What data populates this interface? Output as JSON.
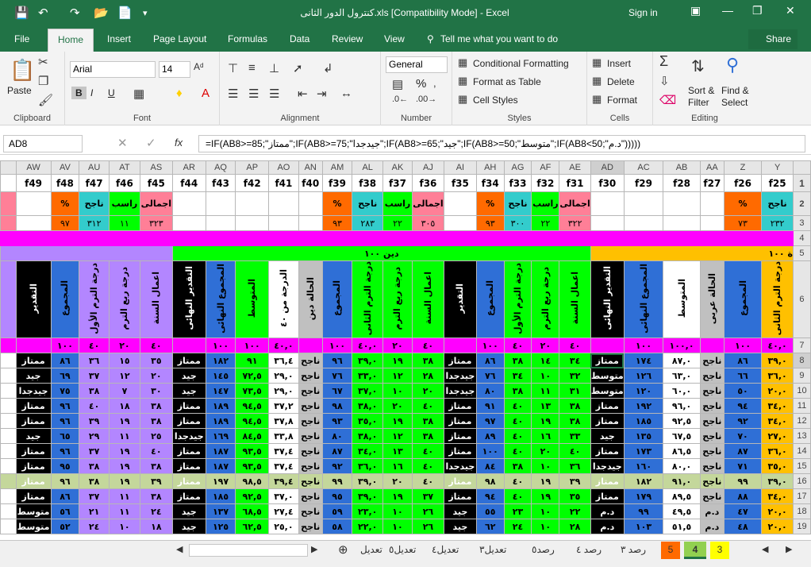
{
  "titlebar": {
    "title": "كنترول الدور الثانى.xls  [Compatibility Mode] - Excel",
    "signin": "Sign in"
  },
  "tabs": [
    "File",
    "Home",
    "Insert",
    "Page Layout",
    "Formulas",
    "Data",
    "Review",
    "View"
  ],
  "tell_me": "Tell me what you want to do",
  "share": "Share",
  "ribbon": {
    "clipboard": {
      "label": "Clipboard",
      "paste": "Paste"
    },
    "font": {
      "label": "Font",
      "name": "Arial",
      "size": "14",
      "bold": "B",
      "italic": "I",
      "underline": "U"
    },
    "alignment": {
      "label": "Alignment"
    },
    "number": {
      "label": "Number",
      "format": "General",
      "pct": "%"
    },
    "styles": {
      "label": "Styles",
      "cond": "Conditional Formatting",
      "table": "Format as Table",
      "cell": "Cell Styles"
    },
    "cells": {
      "label": "Cells",
      "insert": "Insert",
      "delete": "Delete",
      "format": "Format"
    },
    "editing": {
      "label": "Editing",
      "sort": "Sort &",
      "filter": "Filter",
      "find": "Find &",
      "select": "Select"
    }
  },
  "namebox": "AD8",
  "formula": "=IF(AB8>=85;\"ممتاز\";IF(AB8>=75;\"جيدجدا\";IF(AB8>=65;\"جيد\";IF(AB8>=50;\"متوسط\";IF(AB8<50;\"د.م\")))))",
  "colors": {
    "accent": "#217346",
    "magenta": "#ff00ff",
    "green": "#00ff00",
    "blue": "#2f6fd6",
    "purple": "#b386ff",
    "orange": "#ff6a00",
    "yellow": "#ffc000",
    "pink": "#ff7f97",
    "cyan": "#33cccc",
    "gray": "#c0c0c0",
    "olive": "#c4d79b"
  },
  "sheet": {
    "col_letters": [
      "",
      "AW",
      "AV",
      "AU",
      "AT",
      "AS",
      "AR",
      "AQ",
      "AP",
      "AO",
      "AN",
      "AM",
      "AL",
      "AK",
      "AJ",
      "AI",
      "AH",
      "AG",
      "AF",
      "AE",
      "AD",
      "AC",
      "AB",
      "AA",
      "Z",
      "Y",
      ""
    ],
    "row_numbers": [
      "1",
      "2",
      "3",
      "4",
      "5",
      "6",
      "7",
      "8",
      "9",
      "10",
      "11",
      "12",
      "13",
      "14",
      "15",
      "16",
      "17",
      "18",
      "19"
    ],
    "fields": [
      "",
      "f49",
      "f48",
      "f47",
      "f46",
      "f45",
      "f44",
      "f43",
      "f42",
      "f41",
      "f40",
      "f39",
      "f38",
      "f37",
      "f36",
      "f35",
      "f34",
      "f33",
      "f32",
      "f31",
      "f30",
      "f29",
      "f28",
      "f27",
      "f26",
      "f25"
    ],
    "row2": {
      "pct": "%",
      "pass": "ناجح",
      "fail": "راسب",
      "total": "اجمالى"
    },
    "row3": {
      "av": "٩٧",
      "au": "٣١٢",
      "at": "١١",
      "as": "٣٢٣",
      "am": "٩٣",
      "al": "٢٨٣",
      "ak": "٢٢",
      "aj": "٣٠٥",
      "ah": "٩٣",
      "ag": "٣٠٠",
      "af": "٢٢",
      "ae": "٣٢٢",
      "z": "٧٣",
      "y": "٢٣٢"
    },
    "row5": {
      "religion": "دين ١٠٠",
      "arabic": "ة ١٠٠"
    },
    "headers": {
      "grade": "التقدير",
      "total": "المجموع",
      "sec_term": "درجة الترم الثانى",
      "first_term": "درجة الترم الأول",
      "quarter": "درجة ربع الترم",
      "year_work": "اعمال السنة",
      "final_grade": "التقدير النهائى",
      "final_total": "المجموع النهائى",
      "avg": "المتوسط",
      "from40": "الدرجة من ٤٠",
      "religion_status": "الحالة دين",
      "arabic_status": "الحالة عربى"
    },
    "row7": {
      "av": "١٠٠",
      "au": "٤٠",
      "at": "٢٠",
      "as": "٤٠",
      "aq": "١٠٠",
      "ap": "١٠٠",
      "ao": "٤٠,٠",
      "am": "١٠٠",
      "al": "٤٠,٠",
      "ak": "٢٠",
      "aj": "٤٠",
      "ah": "١٠٠",
      "ag": "٤٠",
      "af": "٢٠",
      "ae": "٤٠",
      "ac": "١٠٠",
      "ab": "١٠٠,٠",
      "z": "١٠٠",
      "y": "٤٠,٠"
    },
    "rows": [
      {
        "n": "8",
        "aw": "ممتاز",
        "av": "٨٦",
        "au": "٣٦",
        "at": "١٥",
        "as": "٣٥",
        "ar": "ممتاز",
        "aq": "١٨٢",
        "ap": "٩١",
        "ao": "٣٦,٤",
        "an": "ناجح",
        "am": "٩٦",
        "al": "٣٩,٠",
        "ak": "١٩",
        "aj": "٣٨",
        "ai": "ممتاز",
        "ah": "٨٦",
        "ag": "٣٨",
        "af": "١٤",
        "ae": "٣٤",
        "ad": "ممتاز",
        "ac": "١٧٤",
        "ab": "٨٧,٠",
        "aa": "ناجح",
        "z": "٨٦",
        "y": "٣٩,٠"
      },
      {
        "n": "9",
        "aw": "جيد",
        "av": "٦٩",
        "au": "٣٧",
        "at": "١٢",
        "as": "٢٠",
        "ar": "جيد",
        "aq": "١٤٥",
        "ap": "٧٢,٥",
        "ao": "٢٩,٠",
        "an": "ناجح",
        "am": "٧٦",
        "al": "٣٣,٠",
        "ak": "١٢",
        "aj": "٢٨",
        "ai": "جيدجدا",
        "ah": "٧٦",
        "ag": "٣٤",
        "af": "١٠",
        "ae": "٣٢",
        "ad": "متوسط",
        "ac": "١٢٦",
        "ab": "٦٣,٠",
        "aa": "ناجح",
        "z": "٦٦",
        "y": "٣٦,٠"
      },
      {
        "n": "10",
        "aw": "جيدجدا",
        "av": "٧٥",
        "au": "٣٨",
        "at": "٧",
        "as": "٣٠",
        "ar": "جيد",
        "aq": "١٤٧",
        "ap": "٧٣,٥",
        "ao": "٢٩,٠",
        "an": "ناجح",
        "am": "٦٧",
        "al": "٣٧,٠",
        "ak": "١٠",
        "aj": "٢٠",
        "ai": "جيدجدا",
        "ah": "٨٠",
        "ag": "٣٨",
        "af": "١١",
        "ae": "٣١",
        "ad": "متوسط",
        "ac": "١٢٠",
        "ab": "٦٠,٠",
        "aa": "ناجح",
        "z": "٥٠",
        "y": "٢٠,٠"
      },
      {
        "n": "11",
        "aw": "ممتاز",
        "av": "٩٦",
        "au": "٤٠",
        "at": "١٨",
        "as": "٣٨",
        "ar": "ممتاز",
        "aq": "١٨٩",
        "ap": "٩٤,٥",
        "ao": "٣٧,٢",
        "an": "ناجح",
        "am": "٩٨",
        "al": "٣٨,٠",
        "ak": "٢٠",
        "aj": "٤٠",
        "ai": "ممتاز",
        "ah": "٩١",
        "ag": "٤٠",
        "af": "١٣",
        "ae": "٣٨",
        "ad": "ممتاز",
        "ac": "١٩٢",
        "ab": "٩٦,٠",
        "aa": "ناجح",
        "z": "٩٤",
        "y": "٣٤,٠"
      },
      {
        "n": "12",
        "aw": "ممتاز",
        "av": "٩٦",
        "au": "٣٩",
        "at": "١٩",
        "as": "٣٨",
        "ar": "ممتاز",
        "aq": "١٨٩",
        "ap": "٩٤,٥",
        "ao": "٣٧,٨",
        "an": "ناجح",
        "am": "٩٣",
        "al": "٣٥,٠",
        "ak": "١٩",
        "aj": "٣٨",
        "ai": "ممتاز",
        "ah": "٩٧",
        "ag": "٤٠",
        "af": "١٩",
        "ae": "٣٨",
        "ad": "ممتاز",
        "ac": "١٨٥",
        "ab": "٩٢,٥",
        "aa": "ناجح",
        "z": "٩٢",
        "y": "٣٤,٠"
      },
      {
        "n": "13",
        "aw": "جيد",
        "av": "٦٥",
        "au": "٢٩",
        "at": "١١",
        "as": "٢٥",
        "ar": "جيدجدا",
        "aq": "١٦٩",
        "ap": "٨٤,٥",
        "ao": "٣٣,٨",
        "an": "ناجح",
        "am": "٨٠",
        "al": "٣٨,٠",
        "ak": "١٢",
        "aj": "٣٨",
        "ai": "ممتاز",
        "ah": "٨٩",
        "ag": "٤٠",
        "af": "١٦",
        "ae": "٣٣",
        "ad": "جيد",
        "ac": "١٣٥",
        "ab": "٦٧,٥",
        "aa": "ناجح",
        "z": "٧٠",
        "y": "٢٧,٠"
      },
      {
        "n": "14",
        "aw": "ممتاز",
        "av": "٩٦",
        "au": "٣٧",
        "at": "١٩",
        "as": "٤٠",
        "ar": "ممتاز",
        "aq": "١٨٧",
        "ap": "٩٣,٥",
        "ao": "٣٧,٤",
        "an": "ناجح",
        "am": "٨٧",
        "al": "٣٤,٠",
        "ak": "١٣",
        "aj": "٤٠",
        "ai": "ممتاز",
        "ah": "١٠٠",
        "ag": "٤٠",
        "af": "٢٠",
        "ae": "٤٠",
        "ad": "ممتاز",
        "ac": "١٧٣",
        "ab": "٨٦,٥",
        "aa": "ناجح",
        "z": "٨٧",
        "y": "٣٦,٠"
      },
      {
        "n": "15",
        "aw": "ممتاز",
        "av": "٩٥",
        "au": "٣٨",
        "at": "١٩",
        "as": "٣٨",
        "ar": "ممتاز",
        "aq": "١٨٧",
        "ap": "٩٣,٥",
        "ao": "٣٧,٤",
        "an": "ناجح",
        "am": "٩٢",
        "al": "٣٦,٠",
        "ak": "١٦",
        "aj": "٤٠",
        "ai": "جيدجدا",
        "ah": "٨٤",
        "ag": "٣٨",
        "af": "١٠",
        "ae": "٣٦",
        "ad": "جيدجدا",
        "ac": "١٦٠",
        "ab": "٨٠,٠",
        "aa": "ناجح",
        "z": "٧١",
        "y": "٣٥,٠"
      },
      {
        "n": "16",
        "aw": "ممتاز",
        "av": "٩٦",
        "au": "٣٨",
        "at": "١٩",
        "as": "٣٩",
        "ar": "ممتاز",
        "aq": "١٩٧",
        "ap": "٩٨,٥",
        "ao": "٣٩,٤",
        "an": "ناجح",
        "am": "٩٩",
        "al": "٣٩,٠",
        "ak": "٢٠",
        "aj": "٤٠",
        "ai": "ممتاز",
        "ah": "٩٨",
        "ag": "٤٠",
        "af": "١٩",
        "ae": "٣٩",
        "ad": "ممتاز",
        "ac": "١٨٢",
        "ab": "٩١,٠",
        "aa": "ناجح",
        "z": "٩٩",
        "y": "٣٩,٠"
      },
      {
        "n": "17",
        "aw": "ممتاز",
        "av": "٨٦",
        "au": "٣٧",
        "at": "١١",
        "as": "٣٨",
        "ar": "ممتاز",
        "aq": "١٨٥",
        "ap": "٩٢,٥",
        "ao": "٣٧,٠",
        "an": "ناجح",
        "am": "٩٥",
        "al": "٣٩,٠",
        "ak": "١٩",
        "aj": "٣٧",
        "ai": "ممتاز",
        "ah": "٩٤",
        "ag": "٤٠",
        "af": "١٩",
        "ae": "٣٥",
        "ad": "ممتاز",
        "ac": "١٧٩",
        "ab": "٨٩,٥",
        "aa": "ناجح",
        "z": "٨٨",
        "y": "٣٤,٠"
      },
      {
        "n": "18",
        "aw": "متوسط",
        "av": "٥٦",
        "au": "٢١",
        "at": "١١",
        "as": "٢٤",
        "ar": "جيد",
        "aq": "١٣٧",
        "ap": "٦٨,٥",
        "ao": "٢٧,٤",
        "an": "ناجح",
        "am": "٥٩",
        "al": "٢٣,٠",
        "ak": "١٠",
        "aj": "٢٦",
        "ai": "جيد",
        "ah": "٥٥",
        "ag": "٢٣",
        "af": "١٠",
        "ae": "٢٢",
        "ad": "د.م",
        "ac": "٩٩",
        "ab": "٤٩,٥",
        "aa": "د.م",
        "z": "٤٧",
        "y": "٢٠,٠"
      },
      {
        "n": "19",
        "aw": "متوسط",
        "av": "٥٢",
        "au": "٢٤",
        "at": "١٠",
        "as": "١٨",
        "ar": "جيد",
        "aq": "١٢٥",
        "ap": "٦٢,٥",
        "ao": "٢٥,٠",
        "an": "ناجح",
        "am": "٥٨",
        "al": "٢٢,٠",
        "ak": "١٠",
        "aj": "٢٦",
        "ai": "جيد",
        "ah": "٦٢",
        "ag": "٢٤",
        "af": "١٠",
        "ae": "٢٨",
        "ad": "د.م",
        "ac": "١٠٣",
        "ab": "٥١,٥",
        "aa": "د.م",
        "z": "٤٨",
        "y": "٢٠,٠"
      }
    ]
  },
  "sheet_tabs": [
    "تعديل",
    "تعديل٥",
    "تعديل٤",
    "تعديل٣",
    "رصد٥",
    "رصد ٤",
    "رصد ٣",
    "5",
    "4",
    "3"
  ],
  "status_ready": "Ready"
}
